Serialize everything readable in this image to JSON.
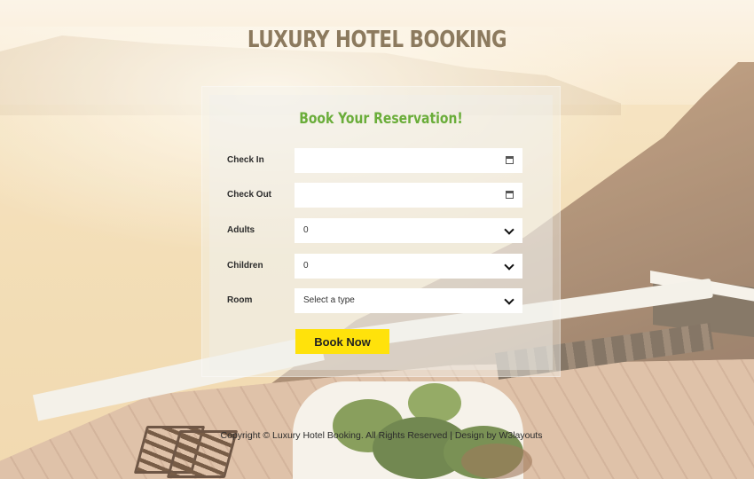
{
  "page": {
    "title": "LUXURY HOTEL BOOKING",
    "subtitle": "Book Your Reservation!"
  },
  "form": {
    "check_in": {
      "label": "Check In",
      "value": "",
      "icon": "calendar-icon"
    },
    "check_out": {
      "label": "Check Out",
      "value": "",
      "icon": "calendar-icon"
    },
    "adults": {
      "label": "Adults",
      "value": "0",
      "icon": "chevron-down-icon"
    },
    "children": {
      "label": "Children",
      "value": "0",
      "icon": "chevron-down-icon"
    },
    "room": {
      "label": "Room",
      "value": "Select a type",
      "icon": "chevron-down-icon"
    },
    "submit_label": "Book Now"
  },
  "footer": {
    "text": "Copyright © Luxury Hotel Booking. All Rights Reserved | Design by W3layouts"
  },
  "colors": {
    "title": "#8c7a5e",
    "subtitle": "#6aad3a",
    "button": "#ffe20b"
  }
}
